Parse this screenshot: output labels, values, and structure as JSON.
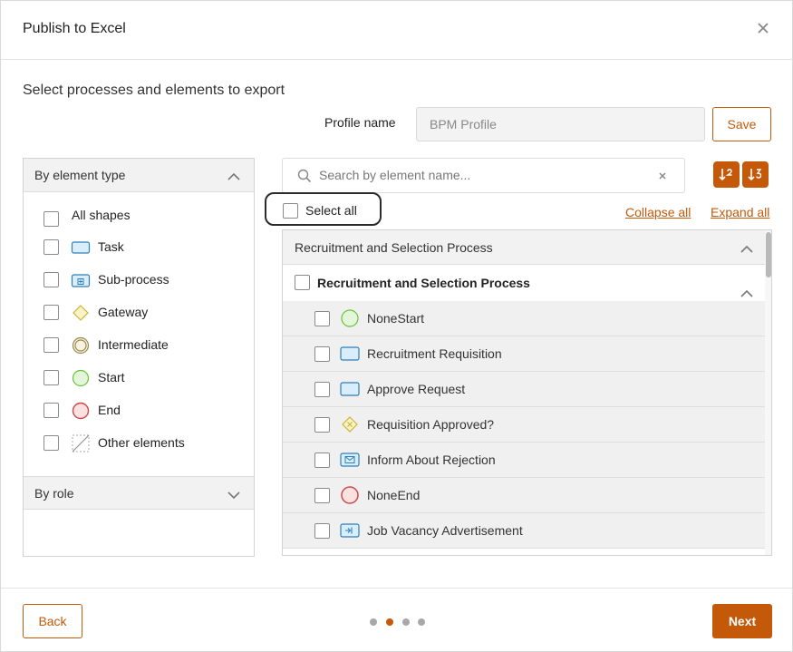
{
  "dialog": {
    "title": "Publish to Excel",
    "subtitle": "Select processes and elements to export"
  },
  "profile": {
    "label": "Profile name",
    "placeholder": "BPM Profile",
    "save_label": "Save"
  },
  "filters": {
    "by_element_type_label": "By element type",
    "by_role_label": "By role",
    "types": [
      {
        "label": "All shapes",
        "icon": "none"
      },
      {
        "label": "Task",
        "icon": "task-icon"
      },
      {
        "label": "Sub-process",
        "icon": "subprocess-icon"
      },
      {
        "label": "Gateway",
        "icon": "gateway-icon"
      },
      {
        "label": "Intermediate",
        "icon": "intermediate-event-icon"
      },
      {
        "label": "Start",
        "icon": "start-event-icon"
      },
      {
        "label": "End",
        "icon": "end-event-icon"
      },
      {
        "label": "Other elements",
        "icon": "other-elements-icon"
      }
    ]
  },
  "search": {
    "placeholder": "Search by element name..."
  },
  "controls": {
    "select_all_label": "Select all",
    "collapse_all_label": "Collapse all",
    "expand_all_label": "Expand all"
  },
  "process_list": {
    "group_header": "Recruitment and Selection Process",
    "process_name": "Recruitment and Selection Process",
    "elements": [
      {
        "label": "NoneStart",
        "icon": "start-event-icon"
      },
      {
        "label": "Recruitment Requisition",
        "icon": "task-icon"
      },
      {
        "label": "Approve Request",
        "icon": "task-icon"
      },
      {
        "label": "Requisition Approved?",
        "icon": "gateway-icon"
      },
      {
        "label": "Inform About Rejection",
        "icon": "send-task-icon"
      },
      {
        "label": "NoneEnd",
        "icon": "end-event-icon"
      },
      {
        "label": "Job Vacancy Advertisement",
        "icon": "manual-task-icon"
      }
    ]
  },
  "footer": {
    "back_label": "Back",
    "next_label": "Next",
    "wizard_step": 2,
    "wizard_steps_total": 4
  },
  "colors": {
    "accent": "#c4590a",
    "task_fill": "#d9eefa",
    "task_stroke": "#2f7fb8",
    "start_fill": "#e3f6d9",
    "start_stroke": "#6cbf3d",
    "end_fill": "#fde0e0",
    "end_stroke": "#c94a4a",
    "gateway_fill": "#faf3c8",
    "gateway_stroke": "#c9b63a"
  }
}
